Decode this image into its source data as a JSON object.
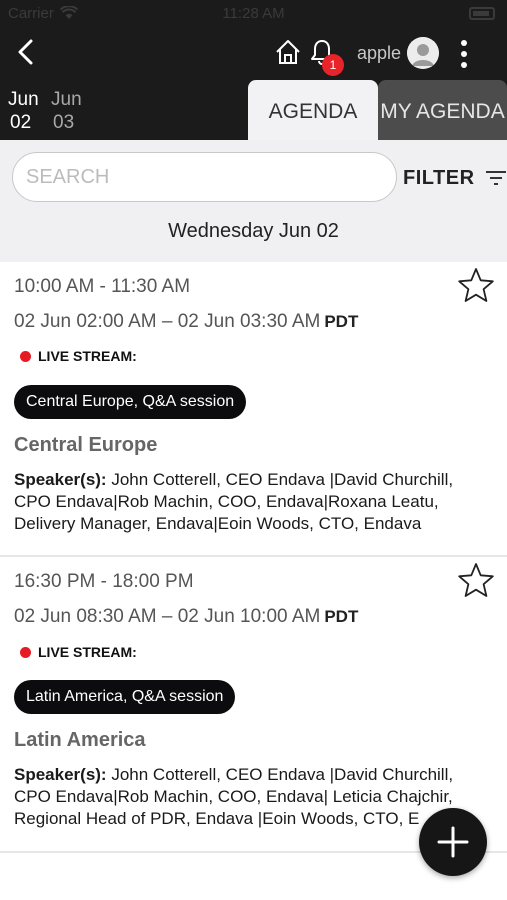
{
  "status_bar": {
    "carrier": "Carrier",
    "time": "11:28 AM"
  },
  "header": {
    "user_name": "apple",
    "notification_count": "1",
    "icons": [
      "back-arrow-icon",
      "home-icon",
      "bell-icon",
      "avatar-icon",
      "more-vertical-icon"
    ]
  },
  "dates": [
    {
      "month": "Jun",
      "day": "02",
      "active": true
    },
    {
      "month": "Jun",
      "day": "03",
      "active": false
    }
  ],
  "tabs": {
    "agenda": "AGENDA",
    "my_agenda": "MY AGENDA"
  },
  "search": {
    "placeholder": "SEARCH",
    "value": ""
  },
  "filter": {
    "label": "FILTER",
    "icon": "filter-lines-icon"
  },
  "day_heading": "Wednesday Jun 02",
  "sessions": [
    {
      "time": "10:00 AM - 11:30 AM",
      "local_time": "02 Jun 02:00 AM – 02 Jun 03:30 AM",
      "timezone": "PDT",
      "live_label": "LIVE STREAM:",
      "pill": "Central Europe, Q&A session",
      "title": "Central Europe",
      "speakers_label": "Speaker(s):",
      "speakers": "John Cotterell, CEO Endava |David Churchill, CPO Endava|Rob Machin, COO, Endava|Roxana Leatu, Delivery Manager, Endava|Eoin Woods, CTO, Endava"
    },
    {
      "time": "16:30 PM - 18:00 PM",
      "local_time": "02 Jun 08:30 AM – 02 Jun 10:00 AM",
      "timezone": "PDT",
      "live_label": "LIVE STREAM:",
      "pill": "Latin America, Q&A session",
      "title": "Latin America",
      "speakers_label": "Speaker(s):",
      "speakers": "John Cotterell, CEO Endava |David Churchill, CPO Endava|Rob Machin, COO, Endava| Leticia Chajchir, Regional Head of PDR, Endava |Eoin Woods, CTO, E"
    }
  ],
  "colors": {
    "header_bg": "#1b1b1b",
    "tab_active_bg": "#f2f2f4",
    "tab_inactive_bg": "#4c4c4c",
    "badge": "#e8232a",
    "live_dot": "#e41b23",
    "pill_bg": "#0c0c0e"
  }
}
